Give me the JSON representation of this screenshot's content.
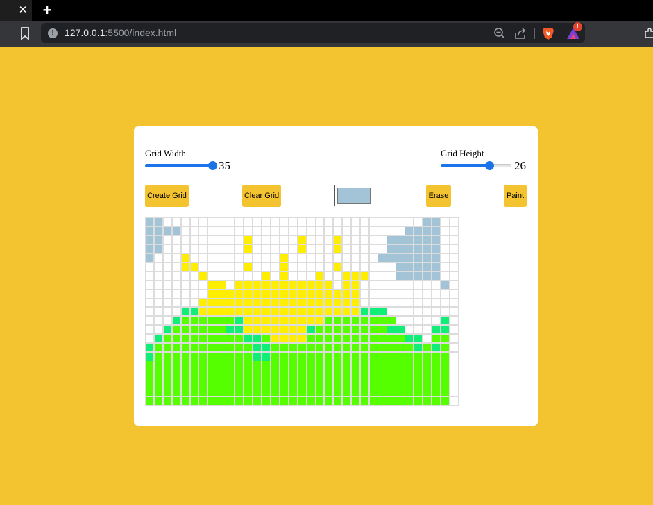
{
  "browser": {
    "url_host": "127.0.0.1",
    "url_rest": ":5500/index.html",
    "close_glyph": "✕",
    "new_tab_glyph": "+",
    "rewards_badge": "1",
    "info_glyph": "!"
  },
  "controls": {
    "grid_width_label": "Grid Width",
    "grid_width_value": "35",
    "grid_width_fraction": 1.0,
    "grid_height_label": "Grid Height",
    "grid_height_value": "26",
    "grid_height_fraction": 0.72,
    "create_label": "Create Grid",
    "clear_label": "Clear Grid",
    "erase_label": "Erase",
    "paint_label": "Paint",
    "selected_color": "#a3c4d6"
  },
  "colors": {
    "page_background": "#f4c430",
    "button": "#f4c430",
    "accent": "#1a73e8",
    "palette": {
      ".": "#ffffff",
      "B": "#a3c4d6",
      "Y": "#ffee00",
      "G": "#55ff00",
      "T": "#11ee77"
    }
  },
  "grid": {
    "columns": 35,
    "rows": 21,
    "pixels": [
      "BB.............................BB",
      "BBBB.........................BBBB",
      "BB.........Y.....Y...Y.....BBBBBB",
      "BB.........Y.....Y...Y.....BBBBBB",
      "B...Y..........Y..........BBBBBBB",
      "....YY.....Y...Y.....Y......BBBBB",
      "......Y......Y.Y...Y..YYY...BBBBB.",
      ".......YY.YYYYYYYYYYY.YY.........B",
      ".......YYYYYYYYYYYYYYYYY..........",
      "......YYYYYYYYYYYYYYYYYY..........",
      "....TTYYYYYYYYYYYYYYYYYYTTT.......",
      "...TGGGGGGTYYYYYYYYYGGGGGGGG.....T",
      "..TGGGGGGTTYYYYYYYTGGGGGGGGTT...TT",
      ".TGGGGGGGGGTTGYYYYGGGGGGGGGGGTT.GG",
      "TGGGGGGGGGGGTTGGGGGGGGGGGGGGGGTGTG",
      "TGGGGGGGGGGGTTGGGGGGGGGGGGGGGGGGGG",
      "GGGGGGGGGGGGGGGGGGGGGGGGGGGGGGGGGG",
      "GGGGGGGGGGGGGGGGGGGGGGGGGGGGGGGGGG",
      "GGGGGGGGGGGGGGGGGGGGGGGGGGGGGGGGGG",
      "GGGGGGGGGGGGGGGGGGGGGGGGGGGGGGGGGG",
      "GGGGGGGGGGGGGGGGGGGGGGGGGGGGGGGGGG"
    ]
  }
}
